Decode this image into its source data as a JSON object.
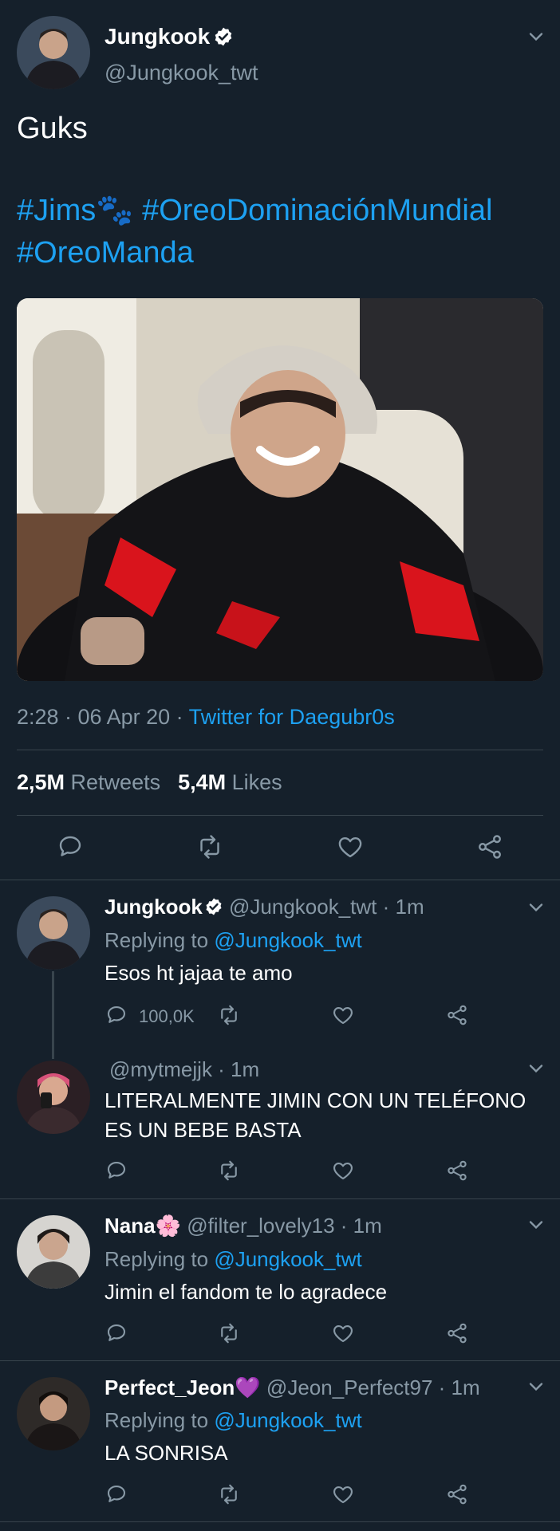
{
  "tweet": {
    "author_name": "Jungkook",
    "author_handle": "@Jungkook_twt",
    "text": "Guks",
    "hashtags_line1": "#Jims🐾 #OreoDominaciónMundial",
    "hashtags_line2": "#OreoManda",
    "time": "2:28 · 06 Apr 20 · ",
    "source": "Twitter for Daegubr0s",
    "retweets_count": "2,5M",
    "retweets_label": " Retweets",
    "likes_count": "5,4M",
    "likes_label": " Likes"
  },
  "replies": [
    {
      "name": "Jungkook",
      "handle": "@Jungkook_twt · 1m",
      "replying_prefix": "Replying to ",
      "replying_to": "@Jungkook_twt",
      "text": "Esos ht jajaa te amo",
      "reply_count": "100,0K"
    },
    {
      "handle": "@mytmejjk · 1m",
      "text_line1": "LITERALMENTE JIMIN CON UN TELÉFONO",
      "text_line2": "ES UN BEBE BASTA"
    },
    {
      "name": "Nana🌸",
      "handle": "@filter_lovely13 · 1m",
      "replying_prefix": "Replying to ",
      "replying_to": "@Jungkook_twt",
      "text": "Jimin el fandom te lo agradece"
    },
    {
      "name": "Perfect_Jeon💜",
      "handle": "@Jeon_Perfect97 · 1m",
      "replying_prefix": "Replying to ",
      "replying_to": "@Jungkook_twt",
      "text": "LA SONRISA"
    }
  ],
  "icons": {
    "verified": "verified-badge-icon",
    "chevron": "chevron-down-icon",
    "reply": "reply-icon",
    "retweet": "retweet-icon",
    "like": "heart-icon",
    "share": "share-icon"
  },
  "colors": {
    "background": "#15202b",
    "link": "#1da1f2",
    "muted": "#8899a6",
    "divider": "#38444d"
  }
}
